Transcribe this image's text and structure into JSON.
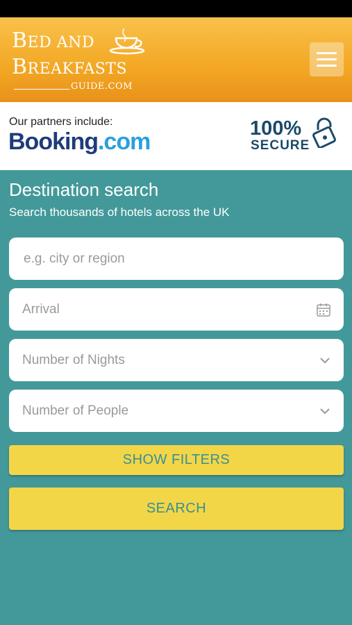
{
  "theme": {
    "teal": "#43999a",
    "orange": "#f3a724",
    "yellow": "#f2d648",
    "button_text": "#3a8f92"
  },
  "header": {
    "logo": {
      "line1_cap": "B",
      "line1_rest": "ED AND",
      "line2_cap": "B",
      "line2_rest": "REAKFASTS",
      "line3": "GUIDE.COM"
    },
    "menu_icon": "hamburger-icon"
  },
  "partners": {
    "label": "Our partners include:",
    "booking_name": "Booking",
    "booking_tld": ".com",
    "secure_percent": "100%",
    "secure_text": "SECURE"
  },
  "search": {
    "title": "Destination search",
    "subtitle": "Search thousands of hotels across the UK",
    "destination_placeholder": "e.g. city or region",
    "arrival_placeholder": "Arrival",
    "nights_placeholder": "Number of Nights",
    "people_placeholder": "Number of People",
    "show_filters_label": "SHOW FILTERS",
    "search_label": "SEARCH"
  }
}
